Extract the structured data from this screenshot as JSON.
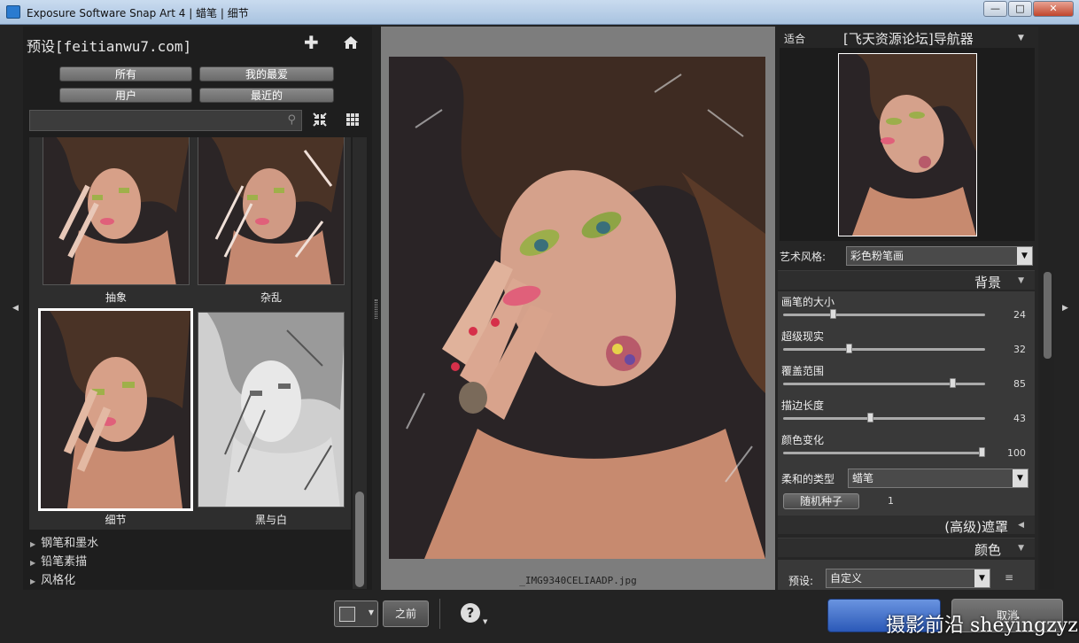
{
  "window": {
    "title": "Exposure Software Snap Art 4 | 蜡笔 | 细节",
    "minimize": "—",
    "maximize": "□",
    "close": "✕"
  },
  "left": {
    "title": "预设[feitianwu7.com]",
    "add_icon": "plus-icon",
    "home_icon": "home-icon",
    "filters": {
      "all": "所有",
      "favorites": "我的最爱",
      "user": "用户",
      "recent": "最近的"
    },
    "search": {
      "placeholder": "",
      "value": ""
    },
    "thumbnails": [
      {
        "label": "抽象"
      },
      {
        "label": "杂乱"
      },
      {
        "label": "细节",
        "selected": true
      },
      {
        "label": "黑与白"
      }
    ],
    "categories": [
      "钢笔和墨水",
      "铅笔素描",
      "风格化"
    ]
  },
  "center": {
    "filename": "_IMG9340CELIAADP.jpg"
  },
  "right": {
    "fit_label": "适合",
    "navigator_title": "[飞天资源论坛]导航器",
    "art_style_label": "艺术风格:",
    "art_style_value": "彩色粉笔画",
    "background_section": "背景",
    "sliders": [
      {
        "label": "画笔的大小",
        "value": 24,
        "max": 100
      },
      {
        "label": "超级现实",
        "value": 32,
        "max": 100
      },
      {
        "label": "覆盖范围",
        "value": 85,
        "max": 100
      },
      {
        "label": "描边长度",
        "value": 43,
        "max": 100
      },
      {
        "label": "颜色变化",
        "value": 100,
        "max": 100
      }
    ],
    "soft_type_label": "柔和的类型",
    "soft_type_value": "蜡笔",
    "random_seed_button": "随机种子",
    "random_seed_value": "1",
    "mask_section": "(高级)遮罩",
    "color_section": "颜色",
    "preset_label": "预设:",
    "preset_value": "自定义"
  },
  "bottom": {
    "before_button": "之前",
    "help_icon": "help-icon",
    "ok_button": "",
    "cancel_button": "取消"
  },
  "watermark": "摄影前沿 sheyingzyz.com"
}
